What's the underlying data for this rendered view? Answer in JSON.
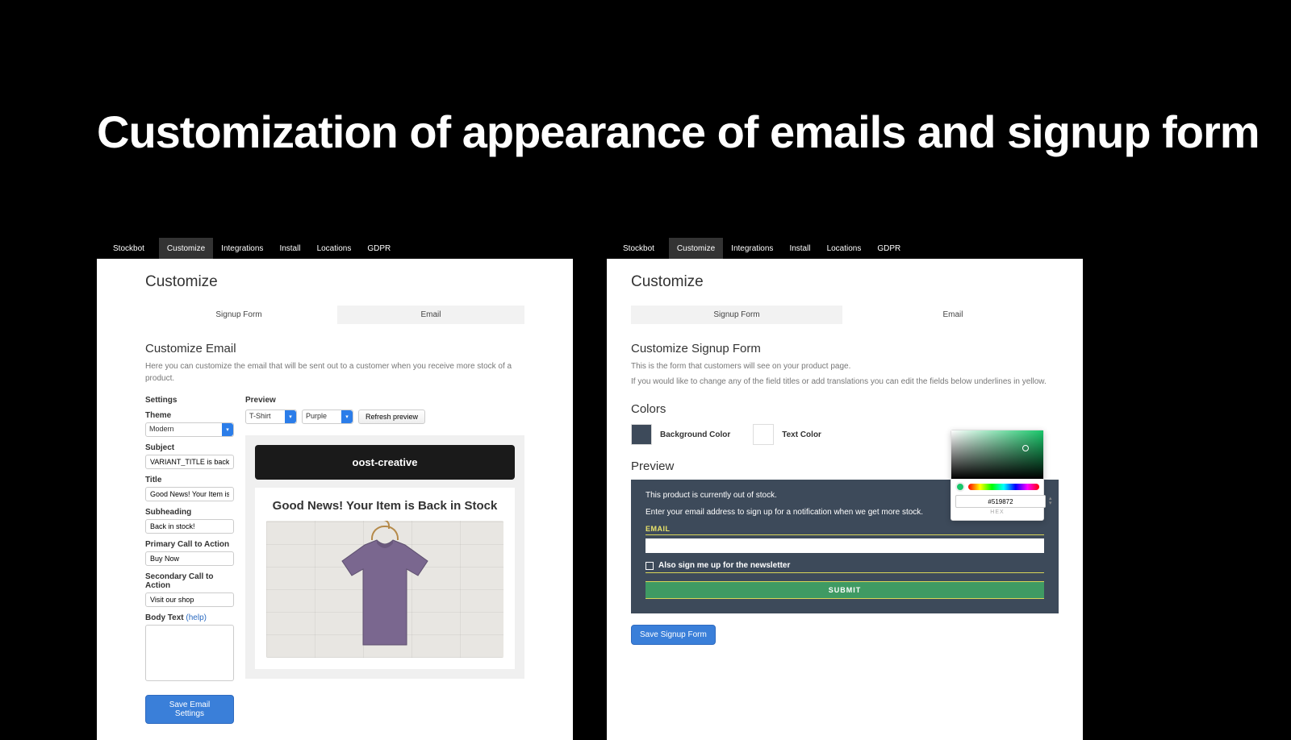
{
  "slide_title": "Customization of appearance of emails and signup form",
  "nav": {
    "brand": "Stockbot",
    "items": [
      "Customize",
      "Integrations",
      "Install",
      "Locations",
      "GDPR"
    ],
    "active": "Customize"
  },
  "left": {
    "page_title": "Customize",
    "tabs": {
      "signup": "Signup Form",
      "email": "Email"
    },
    "section_title": "Customize Email",
    "intro": "Here you can customize the email that will be sent out to a customer when you receive more stock of a product.",
    "col_settings": "Settings",
    "col_preview": "Preview",
    "labels": {
      "theme": "Theme",
      "subject": "Subject",
      "title": "Title",
      "subheading": "Subheading",
      "primary_cta": "Primary Call to Action",
      "secondary_cta": "Secondary Call to Action",
      "body_text": "Body Text",
      "help": "(help)"
    },
    "values": {
      "theme": "Modern",
      "subject": "VARIANT_TITLE is back in stock",
      "title": "Good News! Your Item is Back in S",
      "subheading": "Back in stock!",
      "primary_cta": "Buy Now",
      "secondary_cta": "Visit our shop",
      "body_text": ""
    },
    "preview_controls": {
      "product": "T-Shirt",
      "variant": "Purple",
      "refresh": "Refresh preview"
    },
    "email_preview": {
      "brand": "oost-creative",
      "headline": "Good News! Your Item is Back in Stock"
    },
    "save_btn": "Save Email Settings"
  },
  "right": {
    "page_title": "Customize",
    "tabs": {
      "signup": "Signup Form",
      "email": "Email"
    },
    "section_title": "Customize Signup Form",
    "intro1": "This is the form that customers will see on your product page.",
    "intro2": "If you would like to change any of the field titles or add translations you can edit the fields below underlines in yellow.",
    "colors_heading": "Colors",
    "bg_label": "Background Color",
    "text_label": "Text Color",
    "bg_swatch": "#3d4a5a",
    "text_swatch": "#ffffff",
    "preview_heading": "Preview",
    "preview": {
      "line1": "This product is currently out of stock.",
      "line2": "Enter your email address to sign up for a notification when we get more stock.",
      "email_label": "EMAIL",
      "newsletter": "Also sign me up for the newsletter",
      "submit": "SUBMIT"
    },
    "picker": {
      "hex": "#519872",
      "hex_label": "HEX"
    },
    "save_btn": "Save Signup Form"
  }
}
